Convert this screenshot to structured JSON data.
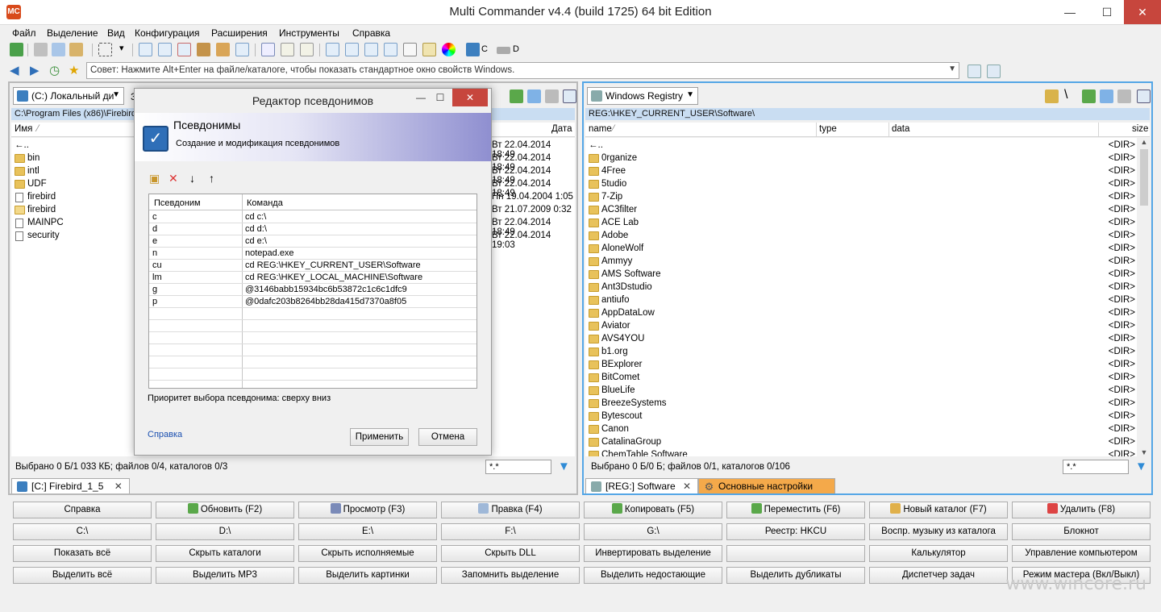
{
  "window": {
    "title": "Multi Commander v4.4 (build 1725) 64 bit Edition",
    "app_icon": "MC",
    "minimize": "—",
    "maximize": "☐",
    "close": "✕"
  },
  "menu": [
    "Файл",
    "Выделение",
    "Вид",
    "Конфигурация",
    "Расширения",
    "Инструменты",
    "Справка"
  ],
  "toolbar": {
    "drive_c": "C",
    "drive_d": "D"
  },
  "hint": {
    "text": "Совет: Нажмите Alt+Enter на файле/каталоге, чтобы показать стандартное окно свойств Windows."
  },
  "left_panel": {
    "drive": "(C:) Локальный ди",
    "extra_char": "З",
    "path": "C:\\Program Files (x86)\\Firebird",
    "col_name": "Имя",
    "col_date": "Дата",
    "items": [
      {
        "name": "←..",
        "type": "up",
        "date": "Вт 22.04.2014 18:49"
      },
      {
        "name": "bin",
        "type": "folder",
        "date": "Вт 22.04.2014 18:49"
      },
      {
        "name": "intl",
        "type": "folder",
        "date": "Вт 22.04.2014 18:49"
      },
      {
        "name": "UDF",
        "type": "folder",
        "date": "Вт 22.04.2014 18:49"
      },
      {
        "name": "firebird",
        "type": "file",
        "date": "Пн 19.04.2004 1:05"
      },
      {
        "name": "firebird",
        "type": "mail",
        "date": "Вт 21.07.2009 0:32"
      },
      {
        "name": "MAINPC",
        "type": "file",
        "date": "Вт 22.04.2014 18:49"
      },
      {
        "name": "security",
        "type": "file",
        "date": "Вт 22.04.2014 19:03"
      }
    ],
    "status": "Выбрано 0 Б/1 033 КБ; файлов 0/4, каталогов 0/3",
    "filter": "*.*",
    "tab": "[C:] Firebird_1_5"
  },
  "right_panel": {
    "drive": "Windows Registry",
    "path": "REG:\\HKEY_CURRENT_USER\\Software\\",
    "col_name": "name",
    "col_type": "type",
    "col_data": "data",
    "col_size": "size",
    "items": [
      {
        "name": "←..",
        "size": "<DIR>"
      },
      {
        "name": "0rganize",
        "size": "<DIR>"
      },
      {
        "name": "4Free",
        "size": "<DIR>"
      },
      {
        "name": "5tudio",
        "size": "<DIR>"
      },
      {
        "name": "7-Zip",
        "size": "<DIR>"
      },
      {
        "name": "AC3filter",
        "size": "<DIR>"
      },
      {
        "name": "ACE Lab",
        "size": "<DIR>"
      },
      {
        "name": "Adobe",
        "size": "<DIR>"
      },
      {
        "name": "AloneWolf",
        "size": "<DIR>"
      },
      {
        "name": "Ammyy",
        "size": "<DIR>"
      },
      {
        "name": "AMS Software",
        "size": "<DIR>"
      },
      {
        "name": "Ant3Dstudio",
        "size": "<DIR>"
      },
      {
        "name": "antiufo",
        "size": "<DIR>"
      },
      {
        "name": "AppDataLow",
        "size": "<DIR>"
      },
      {
        "name": "Aviator",
        "size": "<DIR>"
      },
      {
        "name": "AVS4YOU",
        "size": "<DIR>"
      },
      {
        "name": "b1.org",
        "size": "<DIR>"
      },
      {
        "name": "BExplorer",
        "size": "<DIR>"
      },
      {
        "name": "BitComet",
        "size": "<DIR>"
      },
      {
        "name": "BlueLife",
        "size": "<DIR>"
      },
      {
        "name": "BreezeSystems",
        "size": "<DIR>"
      },
      {
        "name": "Bytescout",
        "size": "<DIR>"
      },
      {
        "name": "Canon",
        "size": "<DIR>"
      },
      {
        "name": "CatalinaGroup",
        "size": "<DIR>"
      },
      {
        "name": "ChemTable Software",
        "size": "<DIR>"
      }
    ],
    "status": "Выбрано 0 Б/0 Б; файлов 0/1, каталогов 0/106",
    "filter": "*.*",
    "tab": "[REG:] Software",
    "tab2": "Основные настройки"
  },
  "fkeys": [
    [
      "Справка",
      "Обновить (F2)",
      "Просмотр (F3)",
      "Правка (F4)",
      "Копировать (F5)",
      "Переместить (F6)",
      "Новый каталог (F7)",
      "Удалить (F8)"
    ],
    [
      "C:\\",
      "D:\\",
      "E:\\",
      "F:\\",
      "G:\\",
      "Реестр: HKCU",
      "Воспр. музыку из каталога",
      "Блокнот"
    ],
    [
      "Показать всё",
      "Скрыть каталоги",
      "Скрыть исполняемые",
      "Скрыть DLL",
      "Инвертировать выделение",
      "",
      "Калькулятор",
      "Управление компьютером"
    ],
    [
      "Выделить всё",
      "Выделить MP3",
      "Выделить картинки",
      "Запомнить выделение",
      "Выделить недостающие",
      "Выделить дубликаты",
      "Диспетчер задач",
      "Режим мастера (Вкл/Выкл)"
    ]
  ],
  "dialog": {
    "title": "Редактор псевдонимов",
    "heading": "Псевдонимы",
    "subheading": "Создание и модификация псевдонимов",
    "col_alias": "Псевдоним",
    "col_command": "Команда",
    "rows": [
      {
        "alias": "c",
        "command": "cd c:\\"
      },
      {
        "alias": "d",
        "command": "cd d:\\"
      },
      {
        "alias": "e",
        "command": "cd e:\\"
      },
      {
        "alias": "n",
        "command": "notepad.exe"
      },
      {
        "alias": "cu",
        "command": "cd REG:\\HKEY_CURRENT_USER\\Software"
      },
      {
        "alias": "lm",
        "command": "cd REG:\\HKEY_LOCAL_MACHINE\\Software"
      },
      {
        "alias": "g",
        "command": "@3146babb15934bc6b53872c1c6c1dfc9"
      },
      {
        "alias": "p",
        "command": "@0dafc203b8264bb28da415d7370a8f05"
      }
    ],
    "priority": "Приоритет выбора псевдонима: сверху вниз",
    "help": "Справка",
    "apply": "Применить",
    "cancel": "Отмена"
  },
  "watermark": "www.wincore.ru"
}
